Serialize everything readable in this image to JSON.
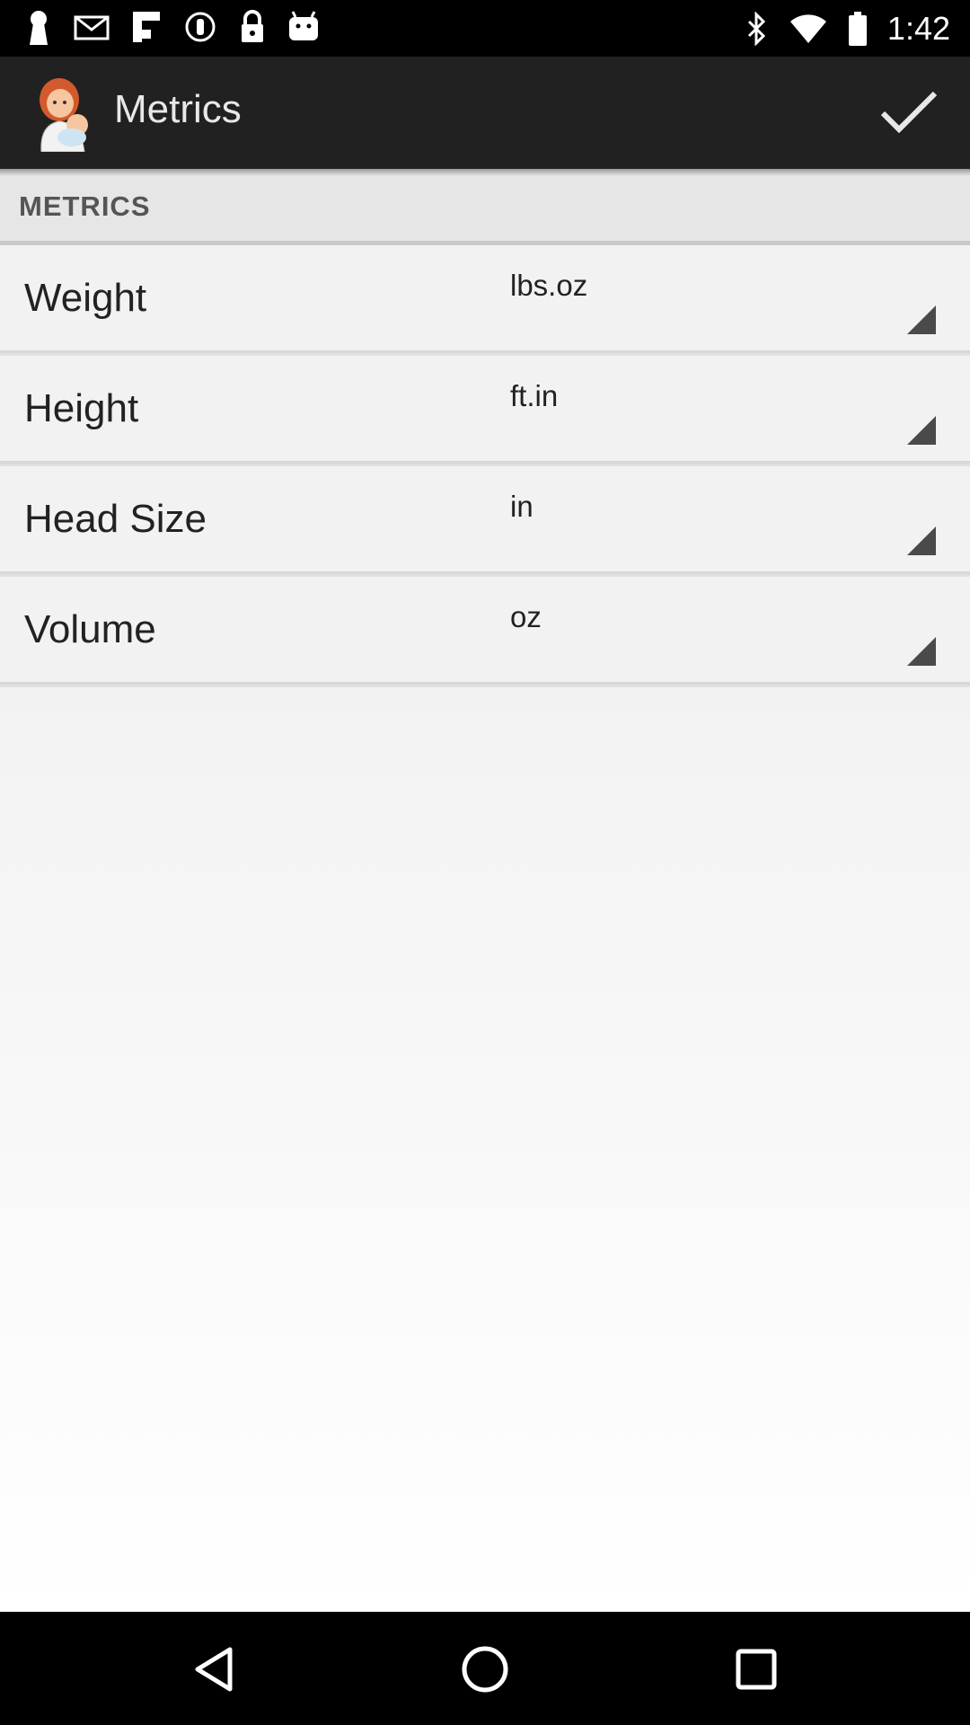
{
  "status_bar": {
    "time": "1:42",
    "left_icons": [
      "keyhole-icon",
      "mail-icon",
      "flipboard-icon",
      "radio-icon",
      "lock-icon",
      "android-icon"
    ],
    "right_icons": [
      "bluetooth-icon",
      "wifi-icon",
      "battery-icon"
    ]
  },
  "app_bar": {
    "title": "Metrics",
    "logo_icon": "mother-baby-logo",
    "confirm_icon": "checkmark-icon"
  },
  "section": {
    "header": "METRICS"
  },
  "preferences": [
    {
      "label": "Weight",
      "value": "lbs.oz"
    },
    {
      "label": "Height",
      "value": "ft.in"
    },
    {
      "label": "Head Size",
      "value": "in"
    },
    {
      "label": "Volume",
      "value": "oz"
    }
  ],
  "nav_bar": {
    "icons": [
      "back-icon",
      "home-icon",
      "recents-icon"
    ]
  },
  "colors": {
    "app_bar": "#212121",
    "status_bar": "#000000",
    "row_background": "#f2f2f2",
    "section_header": "#e6e6e6"
  }
}
